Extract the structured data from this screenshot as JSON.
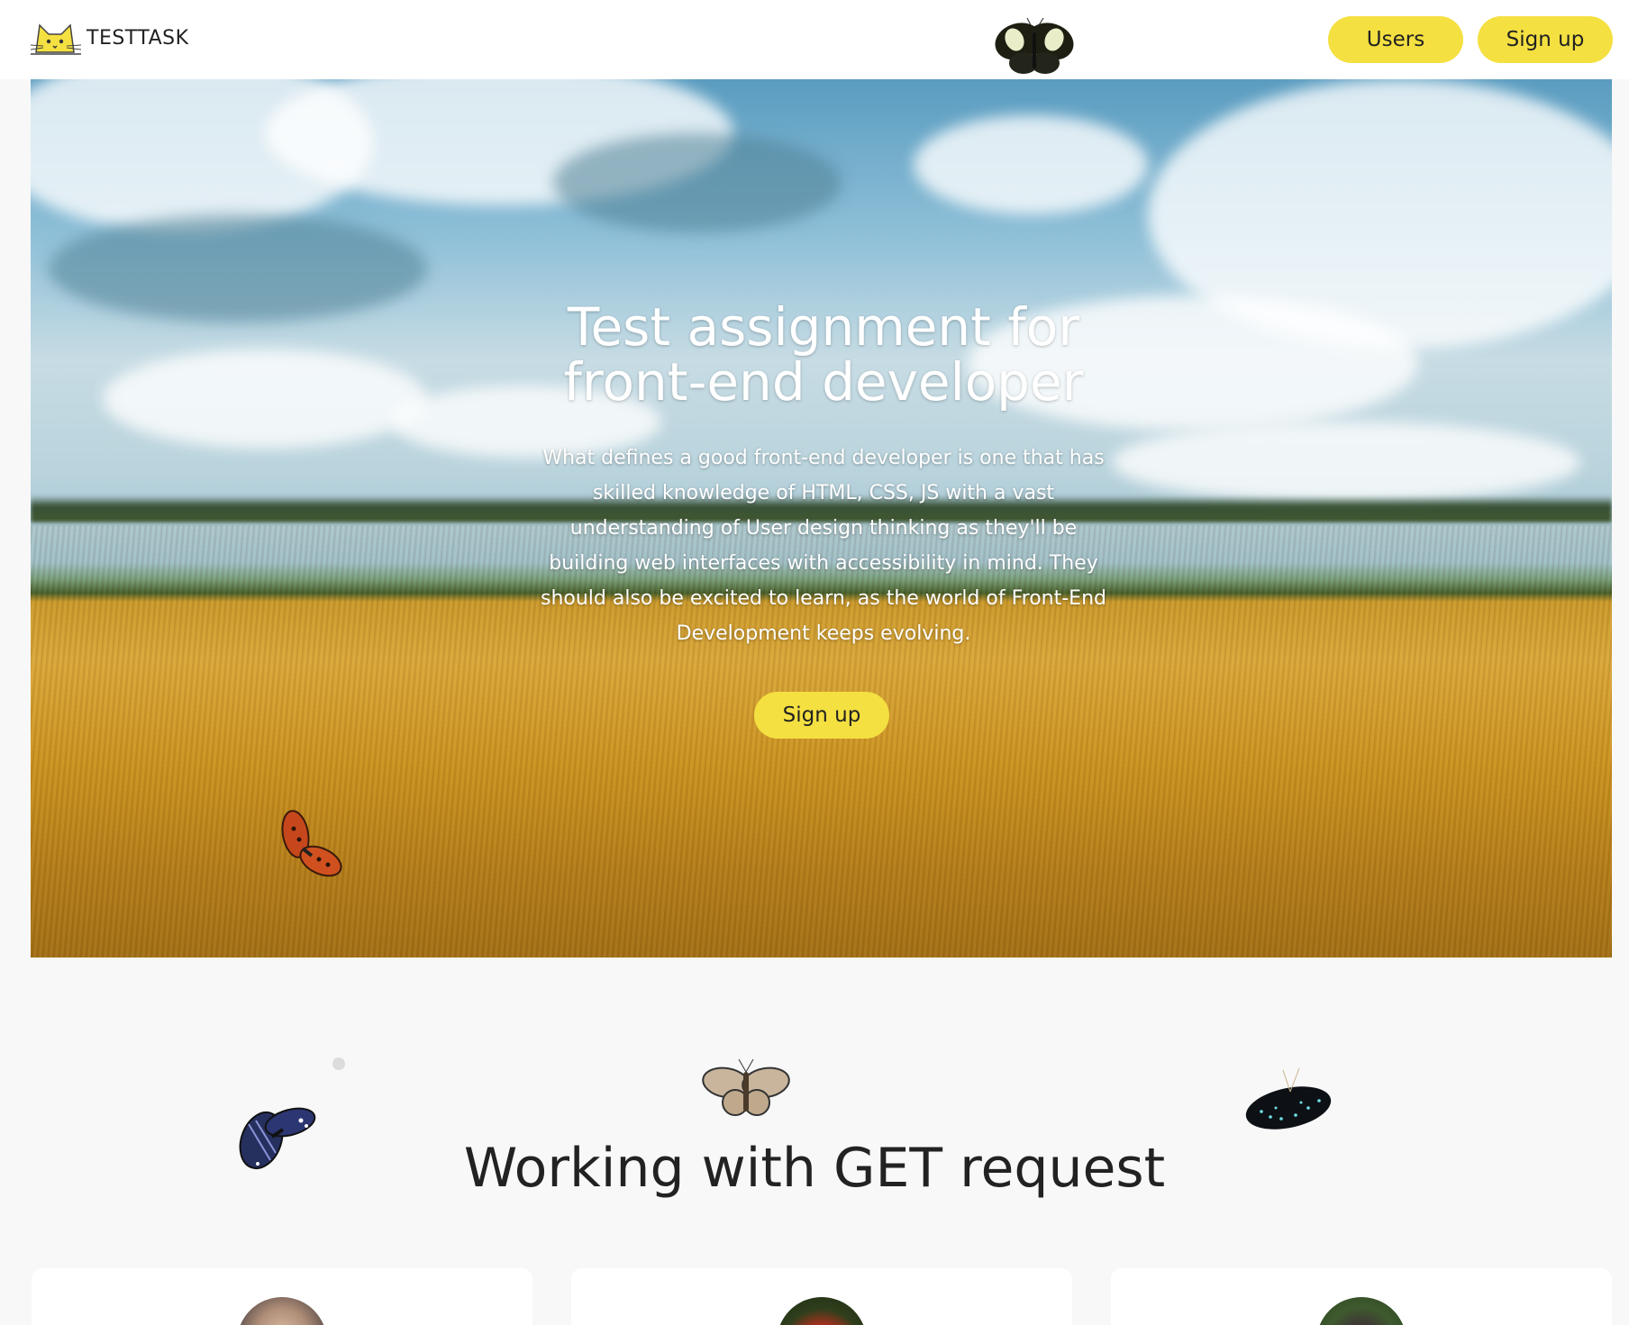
{
  "header": {
    "logo_text": "TESTTASK",
    "nav": [
      {
        "label": "Users"
      },
      {
        "label": "Sign up"
      }
    ]
  },
  "hero": {
    "title_line1": "Test assignment for",
    "title_line2": "front-end developer",
    "text": "What defines a good front-end developer is one that has skilled knowledge of HTML, CSS, JS with a vast understanding of User design thinking as they'll be building web interfaces with accessibility in mind. They should also be excited to learn, as the world of Front-End Development keeps evolving.",
    "button_label": "Sign up"
  },
  "section": {
    "title": "Working with GET request"
  },
  "colors": {
    "accent": "#f4e041",
    "background": "#f8f8f8",
    "text": "#222222"
  },
  "icons": [
    "cat-logo-icon",
    "butterfly-icon"
  ]
}
